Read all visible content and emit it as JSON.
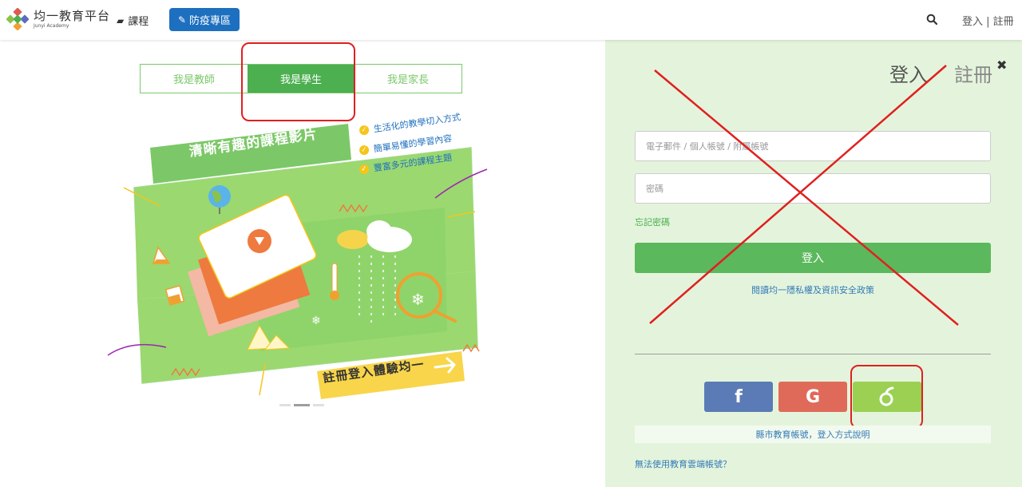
{
  "header": {
    "logo_text": "均一教育平台",
    "logo_sub": "Junyi Academy",
    "nav_course": "課程",
    "nav_covid": "防疫專區",
    "auth_links": "登入 | 註冊",
    "icons": {
      "course": "book-icon",
      "covid": "pencil-icon",
      "search": "search-icon"
    }
  },
  "role_tabs": [
    {
      "label": "我是教師",
      "active": false
    },
    {
      "label": "我是學生",
      "active": true
    },
    {
      "label": "我是家長",
      "active": false
    }
  ],
  "illustration": {
    "title": "清晰有趣的課程影片",
    "features": [
      "生活化的教學切入方式",
      "簡單易懂的學習內容",
      "豐富多元的課程主題"
    ],
    "cta": "註冊登入體驗均一"
  },
  "carousel": {
    "slide_count": 3,
    "active_index": 1
  },
  "login_panel": {
    "login_title": "登入",
    "register_title": "註冊",
    "close_symbol": "✖",
    "email_placeholder": "電子郵件 / 個人帳號 / 附屬帳號",
    "password_placeholder": "密碼",
    "forgot_password": "忘記密碼",
    "login_button": "登入",
    "privacy_text": "閱讀均一隱私權及資訊安全政策",
    "social": {
      "facebook": "f",
      "google": "G"
    },
    "county_account": "縣市教育帳號，登入方式說明",
    "no_cloud": "無法使用教育雲端帳號？"
  },
  "colors": {
    "primary_green": "#4caf50",
    "panel_bg": "#e4f4dc",
    "covid_blue": "#1d6fbf",
    "facebook": "#5b7bb6",
    "google": "#e06a5a",
    "edu_cloud": "#9bd053",
    "annotation_red": "#e02020"
  }
}
